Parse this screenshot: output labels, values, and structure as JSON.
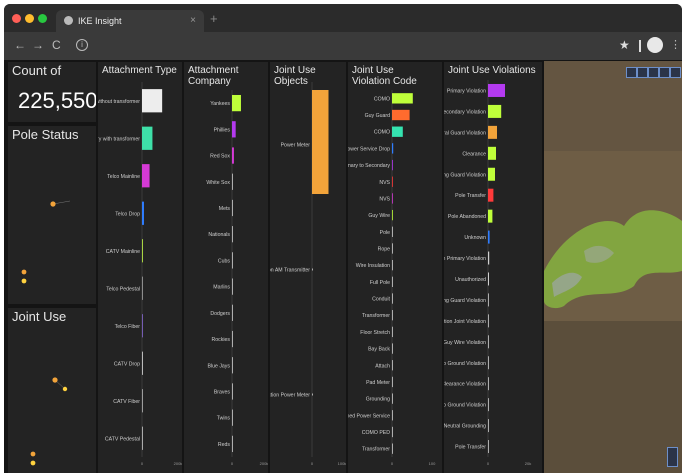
{
  "browser": {
    "tab_title": "IKE Insight",
    "traffic_lights": [
      "#ff5f57",
      "#febc2e",
      "#28c840"
    ]
  },
  "indicator": {
    "title": "Count of",
    "value": "225,550"
  },
  "panels": {
    "pole_status": "Pole Status",
    "joint_use": "Joint Use"
  },
  "chart_data": [
    {
      "type": "bar",
      "orientation": "horizontal",
      "title": "Attachment Type",
      "categories": [
        "Primary and/or Secondary without transformer",
        "Primary and/or Secondary with transformer",
        "Telco Mainline",
        "Telco Drop",
        "CATV Mainline",
        "Telco Pedestal",
        "Telco Fiber",
        "CATV Drop",
        "CATV Fiber",
        "CATV Pedestal"
      ],
      "values": [
        112000,
        58000,
        42000,
        11000,
        1700,
        1000,
        700,
        400,
        300,
        150
      ],
      "colors": [
        "#ededed",
        "#3ee0a8",
        "#d63ad6",
        "#2f7dff",
        "#c9ff4a",
        "#a7a7a7",
        "#8a6ad6",
        "#e0e0e0",
        "#bbbbbb",
        "#cccccc"
      ],
      "xlim": [
        0,
        200000
      ],
      "xticks": [
        "0",
        "200k"
      ]
    },
    {
      "type": "bar",
      "orientation": "horizontal",
      "title": "Attachment Company",
      "categories": [
        "Yankees",
        "Phillies",
        "Red Sox",
        "White Sox",
        "Mets",
        "Nationals",
        "Cubs",
        "Marlins",
        "Dodgers",
        "Rockies",
        "Blue Jays",
        "Braves",
        "Twins",
        "Reds"
      ],
      "values": [
        56000,
        23000,
        12000,
        1600,
        700,
        400,
        300,
        200,
        150,
        100,
        60,
        40,
        20,
        10
      ],
      "colors": [
        "#bfff3a",
        "#b43af0",
        "#d63ad6",
        "#d0d0d0",
        "#d0d0d0",
        "#d0d0d0",
        "#d0d0d0",
        "#d0d0d0",
        "#d0d0d0",
        "#d0d0d0",
        "#d0d0d0",
        "#d0d0d0",
        "#d0d0d0",
        "#d0d0d0"
      ],
      "xlim": [
        0,
        200000
      ],
      "xticks": [
        "0",
        "200k"
      ]
    },
    {
      "type": "bar",
      "orientation": "horizontal",
      "title": "Joint Use Objects",
      "categories": [
        "Power Meter",
        "Verizon AM Transmitter",
        "Verizon AM Fiber Connection Power Meter"
      ],
      "values": [
        55000,
        800,
        300
      ],
      "colors": [
        "#f2a33a",
        "#d0d0d0",
        "#d0d0d0"
      ],
      "xlim": [
        0,
        100000
      ],
      "xticks": [
        "0",
        "100k"
      ]
    },
    {
      "type": "bar",
      "orientation": "horizontal",
      "title": "Joint Use Violation Code",
      "categories": [
        "COMO",
        "Guy Guard",
        "COMO",
        "Power Service Drop",
        "Primary to Secondary",
        "NVS",
        "NVS",
        "Guy Wire",
        "Pole",
        "Rope",
        "Wire Insulation",
        "Full Pole",
        "Conduit",
        "Transformer",
        "Floor Stretch",
        "Bay Back",
        "Attach",
        "Pad Meter",
        "Grounding",
        "Abandoned Power Service",
        "COMO PED",
        "Transformer"
      ],
      "values": [
        52000,
        44000,
        27000,
        3000,
        2000,
        1500,
        1200,
        1000,
        800,
        600,
        500,
        400,
        350,
        300,
        250,
        200,
        150,
        120,
        100,
        80,
        60,
        40
      ],
      "colors": [
        "#bfff3a",
        "#ff6b2e",
        "#35e3b0",
        "#2f7dff",
        "#b43af0",
        "#ff3a3a",
        "#d63ad6",
        "#bfff3a",
        "#d0d0d0",
        "#d0d0d0",
        "#d0d0d0",
        "#d0d0d0",
        "#d0d0d0",
        "#d0d0d0",
        "#d0d0d0",
        "#d0d0d0",
        "#d0d0d0",
        "#d0d0d0",
        "#d0d0d0",
        "#d0d0d0",
        "#d0d0d0",
        "#d0d0d0"
      ],
      "xlim": [
        0,
        100000
      ],
      "xticks": [
        "0",
        "100"
      ]
    },
    {
      "type": "bar",
      "orientation": "horizontal",
      "title": "Joint Use Violations",
      "categories": [
        "Primary Violation",
        "Primary to Secondary Violation",
        "Neutral Guard Violation",
        "Clearance",
        "Missing Guard Violation",
        "Pole Transfer",
        "Pole Abandoned",
        "Unknown",
        "Separation Primary Violation",
        "Unauthorized",
        "Missing Guard Violation",
        "Separation Joint Violation",
        "Clearance to Guy Wire Violation",
        "Separation to Ground Violation",
        "Separation Clearance Violation",
        "Separation to Ground Violation",
        "Neutral Grounding",
        "Pole Transfer"
      ],
      "values": [
        8500,
        6600,
        4500,
        4000,
        3500,
        2700,
        2200,
        800,
        600,
        500,
        400,
        300,
        250,
        200,
        150,
        120,
        100,
        80
      ],
      "colors": [
        "#b43af0",
        "#bfff3a",
        "#f2a33a",
        "#bfff3a",
        "#bfff3a",
        "#ff3a3a",
        "#bfff3a",
        "#2f7dff",
        "#d0d0d0",
        "#d0d0d0",
        "#d0d0d0",
        "#d0d0d0",
        "#d0d0d0",
        "#d0d0d0",
        "#d0d0d0",
        "#d0d0d0",
        "#d0d0d0",
        "#d0d0d0"
      ],
      "xlim": [
        0,
        20000
      ],
      "xticks": [
        "0",
        "20k"
      ]
    }
  ]
}
